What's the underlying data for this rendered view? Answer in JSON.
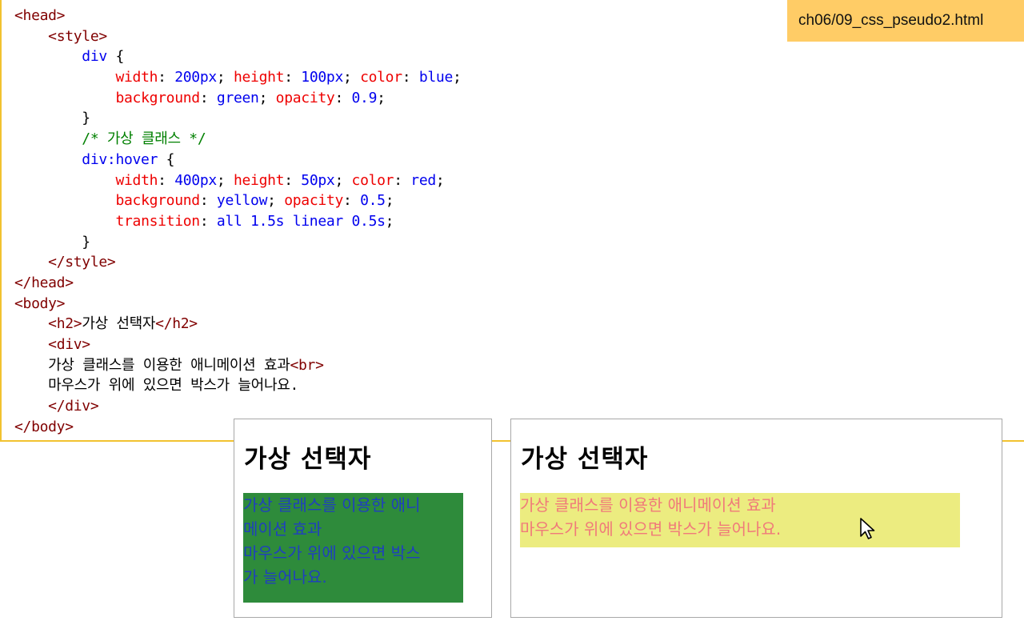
{
  "file_label": "ch06/09_css_pseudo2.html",
  "code": [
    [
      [
        "tag",
        "<head>"
      ]
    ],
    [
      [
        "pn",
        "    "
      ],
      [
        "tag",
        "<style>"
      ]
    ],
    [
      [
        "pn",
        "        "
      ],
      [
        "val",
        "div"
      ],
      [
        "pn",
        " {"
      ]
    ],
    [
      [
        "pn",
        "            "
      ],
      [
        "prop",
        "width"
      ],
      [
        "pn",
        ": "
      ],
      [
        "val",
        "200px"
      ],
      [
        "pn",
        "; "
      ],
      [
        "prop",
        "height"
      ],
      [
        "pn",
        ": "
      ],
      [
        "val",
        "100px"
      ],
      [
        "pn",
        "; "
      ],
      [
        "prop",
        "color"
      ],
      [
        "pn",
        ": "
      ],
      [
        "val",
        "blue"
      ],
      [
        "pn",
        ";"
      ]
    ],
    [
      [
        "pn",
        "            "
      ],
      [
        "prop",
        "background"
      ],
      [
        "pn",
        ": "
      ],
      [
        "val",
        "green"
      ],
      [
        "pn",
        "; "
      ],
      [
        "prop",
        "opacity"
      ],
      [
        "pn",
        ": "
      ],
      [
        "val",
        "0.9"
      ],
      [
        "pn",
        ";"
      ]
    ],
    [
      [
        "pn",
        "        }"
      ]
    ],
    [
      [
        "pn",
        "        "
      ],
      [
        "cm",
        "/* 가상 클래스 */"
      ]
    ],
    [
      [
        "pn",
        "        "
      ],
      [
        "val",
        "div:hover"
      ],
      [
        "pn",
        " {"
      ]
    ],
    [
      [
        "pn",
        "            "
      ],
      [
        "prop",
        "width"
      ],
      [
        "pn",
        ": "
      ],
      [
        "val",
        "400px"
      ],
      [
        "pn",
        "; "
      ],
      [
        "prop",
        "height"
      ],
      [
        "pn",
        ": "
      ],
      [
        "val",
        "50px"
      ],
      [
        "pn",
        "; "
      ],
      [
        "prop",
        "color"
      ],
      [
        "pn",
        ": "
      ],
      [
        "val",
        "red"
      ],
      [
        "pn",
        ";"
      ]
    ],
    [
      [
        "pn",
        "            "
      ],
      [
        "prop",
        "background"
      ],
      [
        "pn",
        ": "
      ],
      [
        "val",
        "yellow"
      ],
      [
        "pn",
        "; "
      ],
      [
        "prop",
        "opacity"
      ],
      [
        "pn",
        ": "
      ],
      [
        "val",
        "0.5"
      ],
      [
        "pn",
        ";"
      ]
    ],
    [
      [
        "pn",
        "            "
      ],
      [
        "prop",
        "transition"
      ],
      [
        "pn",
        ": "
      ],
      [
        "val",
        "all 1.5s linear 0.5s"
      ],
      [
        "pn",
        ";"
      ]
    ],
    [
      [
        "pn",
        "        }"
      ]
    ],
    [
      [
        "pn",
        "    "
      ],
      [
        "tag",
        "</style>"
      ]
    ],
    [
      [
        "tag",
        "</head>"
      ]
    ],
    [
      [
        "tag",
        "<body>"
      ]
    ],
    [
      [
        "pn",
        "    "
      ],
      [
        "tag",
        "<h2>"
      ],
      [
        "txt",
        "가상 선택자"
      ],
      [
        "tag",
        "</h2>"
      ]
    ],
    [
      [
        "pn",
        "    "
      ],
      [
        "tag",
        "<div>"
      ]
    ],
    [
      [
        "pn",
        "    "
      ],
      [
        "txt",
        "가상 클래스를 이용한 애니메이션 효과"
      ],
      [
        "tag",
        "<br>"
      ]
    ],
    [
      [
        "pn",
        "    "
      ],
      [
        "txt",
        "마우스가 위에 있으면 박스가 늘어나요."
      ]
    ],
    [
      [
        "pn",
        "    "
      ],
      [
        "tag",
        "</div>"
      ]
    ],
    [
      [
        "tag",
        "</body>"
      ]
    ]
  ],
  "preview_normal": {
    "heading": "가상 선택자",
    "lines": [
      "가상 클래스를 이용한 애니",
      "메이션 효과",
      "마우스가 위에 있으면 박스",
      "가 늘어나요."
    ],
    "bg_color": "#2e8b3b",
    "text_color": "#1f3fbf"
  },
  "preview_hover": {
    "heading": "가상 선택자",
    "lines": [
      "가상 클래스를 이용한 애니메이션 효과",
      "마우스가 위에 있으면 박스가 늘어나요."
    ],
    "bg_color": "#ecec80",
    "text_color": "#f07a7a",
    "cursor_icon": "arrow-cursor-icon"
  },
  "colors": {
    "tag": "#800000",
    "property": "#ee0000",
    "value": "#0000ee",
    "comment": "#008000",
    "label_bg": "#ffcc66",
    "panel_border": "#f2c230"
  }
}
